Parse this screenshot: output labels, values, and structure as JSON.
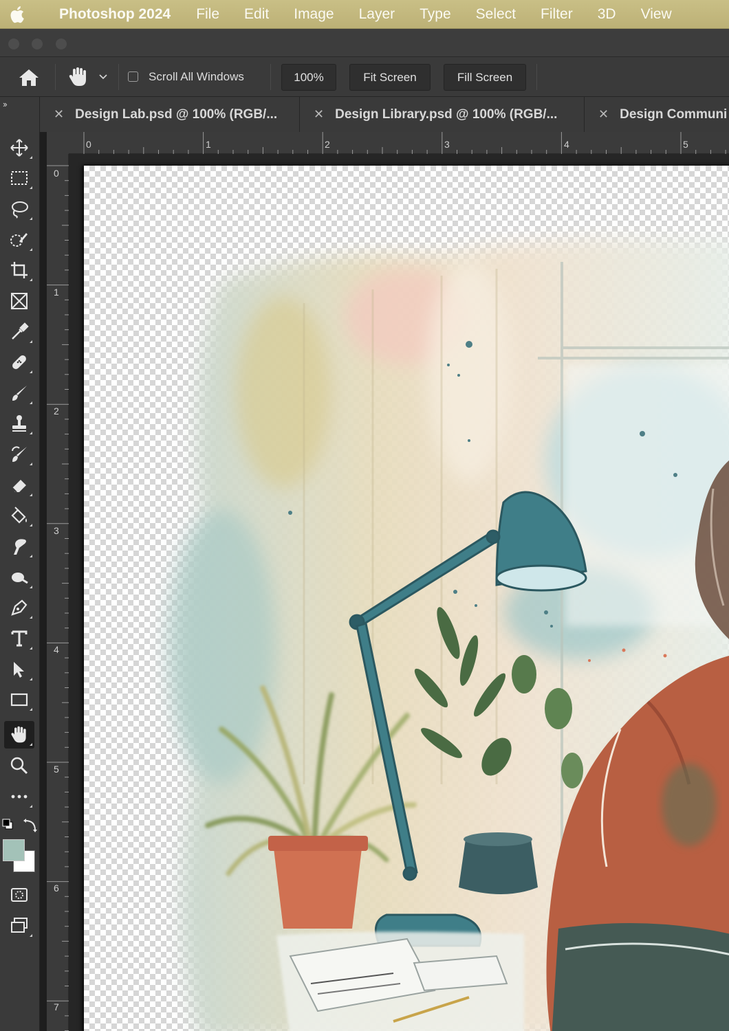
{
  "menubar": {
    "app_name": "Photoshop 2024",
    "items": [
      "File",
      "Edit",
      "Image",
      "Layer",
      "Type",
      "Select",
      "Filter",
      "3D",
      "View"
    ]
  },
  "options_bar": {
    "scroll_all_windows_label": "Scroll All Windows",
    "scroll_all_windows_checked": false,
    "zoom_button": "100%",
    "fit_screen_button": "Fit Screen",
    "fill_screen_button": "Fill Screen"
  },
  "tabs": [
    {
      "title": "Design Lab.psd @ 100% (RGB/..."
    },
    {
      "title": "Design Library.psd @ 100% (RGB/..."
    },
    {
      "title": "Design Communi"
    }
  ],
  "rulers": {
    "horizontal": [
      "0",
      "1",
      "2",
      "3",
      "4",
      "5"
    ],
    "vertical": [
      "0",
      "1",
      "2",
      "3",
      "4",
      "5",
      "6",
      "7"
    ]
  },
  "tools": [
    "move-tool",
    "marquee-tool",
    "lasso-tool",
    "quick-selection-tool",
    "crop-tool",
    "frame-tool",
    "eyedropper-tool",
    "healing-brush-tool",
    "brush-tool",
    "clone-stamp-tool",
    "history-brush-tool",
    "eraser-tool",
    "paint-bucket-tool",
    "smudge-tool",
    "dodge-tool",
    "pen-tool",
    "type-tool",
    "path-selection-tool",
    "rectangle-tool",
    "hand-tool",
    "zoom-tool",
    "more-tools"
  ],
  "active_tool": "hand-tool",
  "colors": {
    "foreground": "#a3c2b8",
    "background": "#ffffff",
    "menubar": "#c4b97e"
  }
}
